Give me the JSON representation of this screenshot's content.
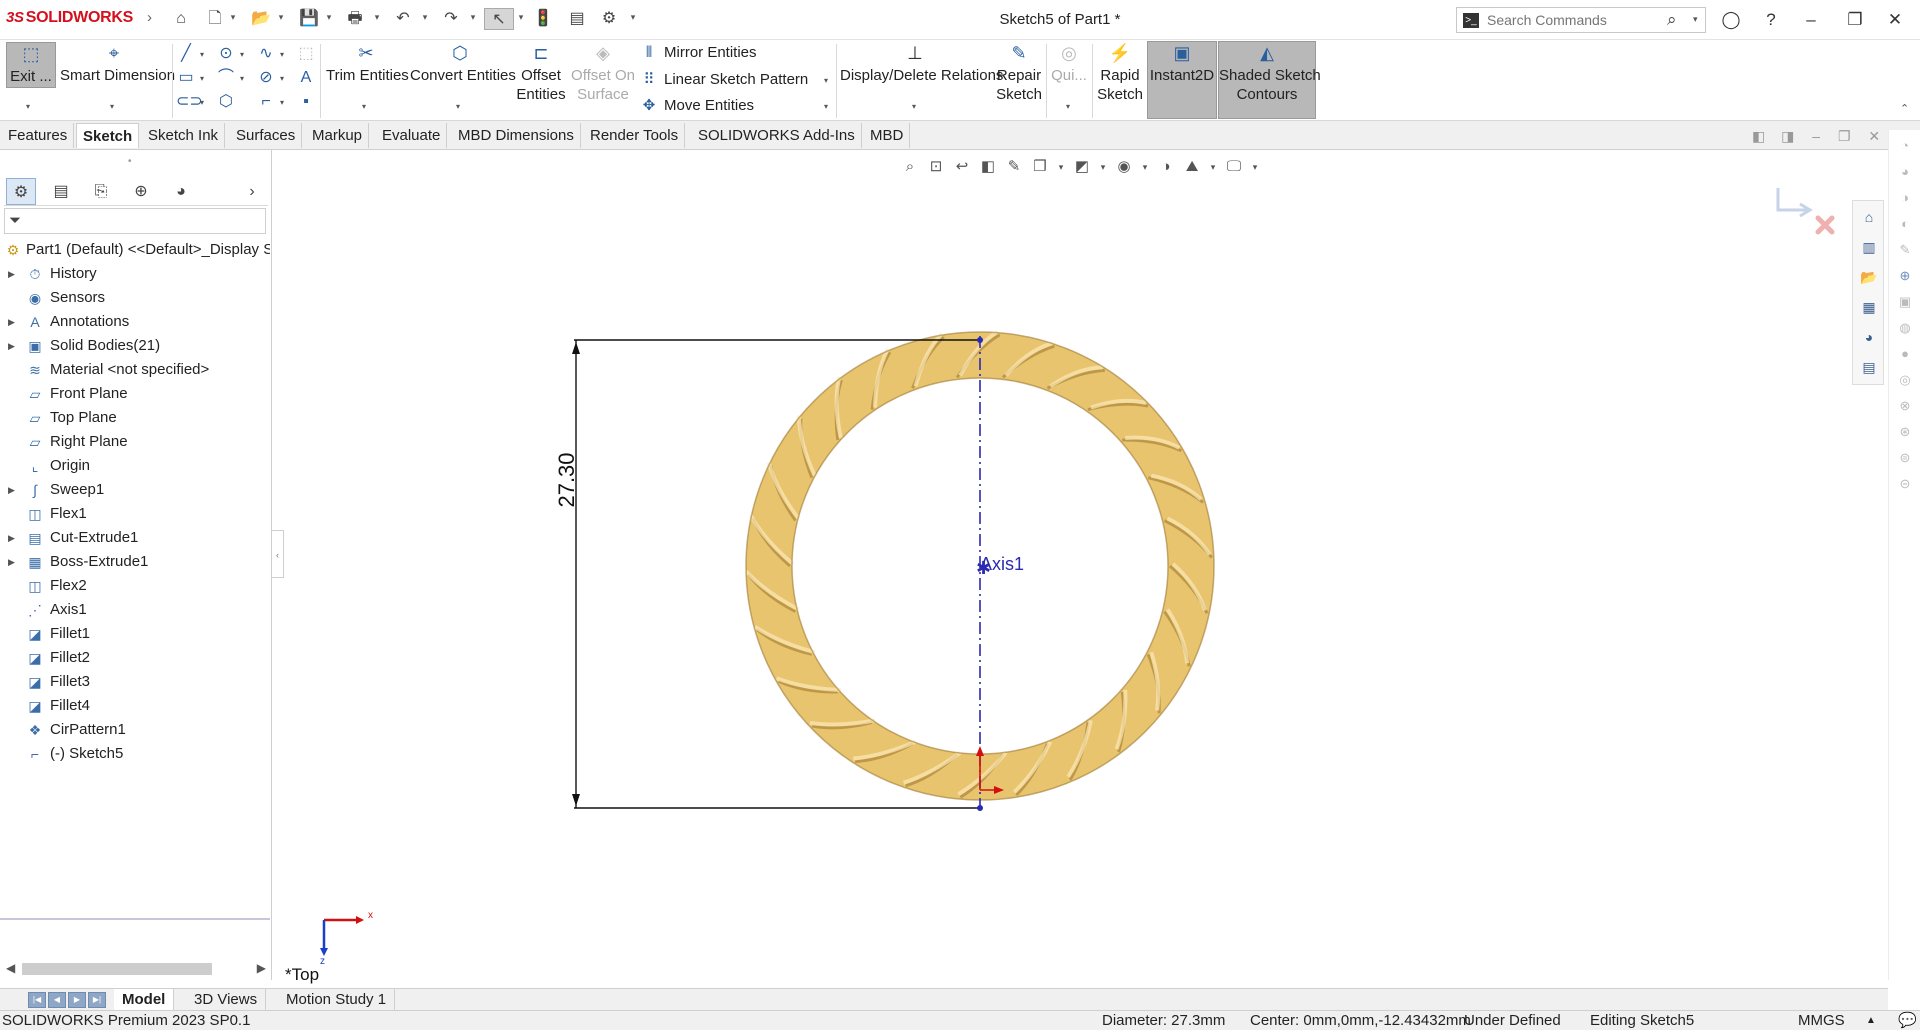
{
  "app": {
    "brand": "SOLIDWORKS",
    "brand_prefix": "3S",
    "doc_title": "Sketch5 of Part1 *"
  },
  "search": {
    "placeholder": "Search Commands"
  },
  "ribbon": {
    "exit_label": "Exit ...",
    "smart_dimension": "Smart Dimension",
    "trim_entities": "Trim Entities",
    "convert_entities": "Convert Entities",
    "offset_entities_1": "Offset",
    "offset_entities_2": "Entities",
    "offset_on_surface_1": "Offset On",
    "offset_on_surface_2": "Surface",
    "mirror_entities": "Mirror Entities",
    "linear_sketch_pattern": "Linear Sketch Pattern",
    "move_entities": "Move Entities",
    "display_delete_relations": "Display/Delete Relations",
    "repair_sketch_1": "Repair",
    "repair_sketch_2": "Sketch",
    "quick_snaps": "Qui...",
    "rapid_sketch_1": "Rapid",
    "rapid_sketch_2": "Sketch",
    "instant2d": "Instant2D",
    "shaded_contours_1": "Shaded Sketch",
    "shaded_contours_2": "Contours"
  },
  "tabs": [
    "Features",
    "Sketch",
    "Sketch Ink",
    "Surfaces",
    "Markup",
    "Evaluate",
    "MBD Dimensions",
    "Render Tools",
    "SOLIDWORKS Add-Ins",
    "MBD"
  ],
  "active_tab": "Sketch",
  "tree": {
    "root": "Part1 (Default) <<Default>_Display S",
    "items": [
      {
        "label": "History",
        "icon": "history-icon",
        "expandable": true
      },
      {
        "label": "Sensors",
        "icon": "sensor-icon",
        "expandable": false
      },
      {
        "label": "Annotations",
        "icon": "annotation-icon",
        "expandable": true
      },
      {
        "label": "Solid Bodies(21)",
        "icon": "solid-bodies-icon",
        "expandable": true
      },
      {
        "label": "Material <not specified>",
        "icon": "material-icon",
        "expandable": false
      },
      {
        "label": "Front Plane",
        "icon": "plane-icon",
        "expandable": false
      },
      {
        "label": "Top Plane",
        "icon": "plane-icon",
        "expandable": false
      },
      {
        "label": "Right Plane",
        "icon": "plane-icon",
        "expandable": false
      },
      {
        "label": "Origin",
        "icon": "origin-icon",
        "expandable": false
      },
      {
        "label": "Sweep1",
        "icon": "sweep-icon",
        "expandable": true
      },
      {
        "label": "Flex1",
        "icon": "flex-icon",
        "expandable": false
      },
      {
        "label": "Cut-Extrude1",
        "icon": "cut-extrude-icon",
        "expandable": true
      },
      {
        "label": "Boss-Extrude1",
        "icon": "boss-extrude-icon",
        "expandable": true
      },
      {
        "label": "Flex2",
        "icon": "flex-icon",
        "expandable": false
      },
      {
        "label": "Axis1",
        "icon": "axis-icon",
        "expandable": false
      },
      {
        "label": "Fillet1",
        "icon": "fillet-icon",
        "expandable": false
      },
      {
        "label": "Fillet2",
        "icon": "fillet-icon",
        "expandable": false
      },
      {
        "label": "Fillet3",
        "icon": "fillet-icon",
        "expandable": false
      },
      {
        "label": "Fillet4",
        "icon": "fillet-icon",
        "expandable": false
      },
      {
        "label": "CirPattern1",
        "icon": "circular-pattern-icon",
        "expandable": false
      },
      {
        "label": "(-) Sketch5",
        "icon": "sketch-icon",
        "expandable": false
      }
    ]
  },
  "graphics": {
    "dimension_value": "27.30",
    "axis_label": "Axis1",
    "view_label": "*Top",
    "triad_x": "x",
    "triad_z": "z",
    "ring_color": "#E9C46F",
    "ring_shadow": "#B08A3A",
    "axis_color": "#2B2BB0"
  },
  "bottom_tabs": [
    "Model",
    "3D Views",
    "Motion Study 1"
  ],
  "status": {
    "version": "SOLIDWORKS Premium 2023 SP0.1",
    "diameter": "Diameter: 27.3mm",
    "center": "Center: 0mm,0mm,-12.43432mm",
    "state": "Under Defined",
    "editing": "Editing Sketch5",
    "units": "MMGS"
  }
}
